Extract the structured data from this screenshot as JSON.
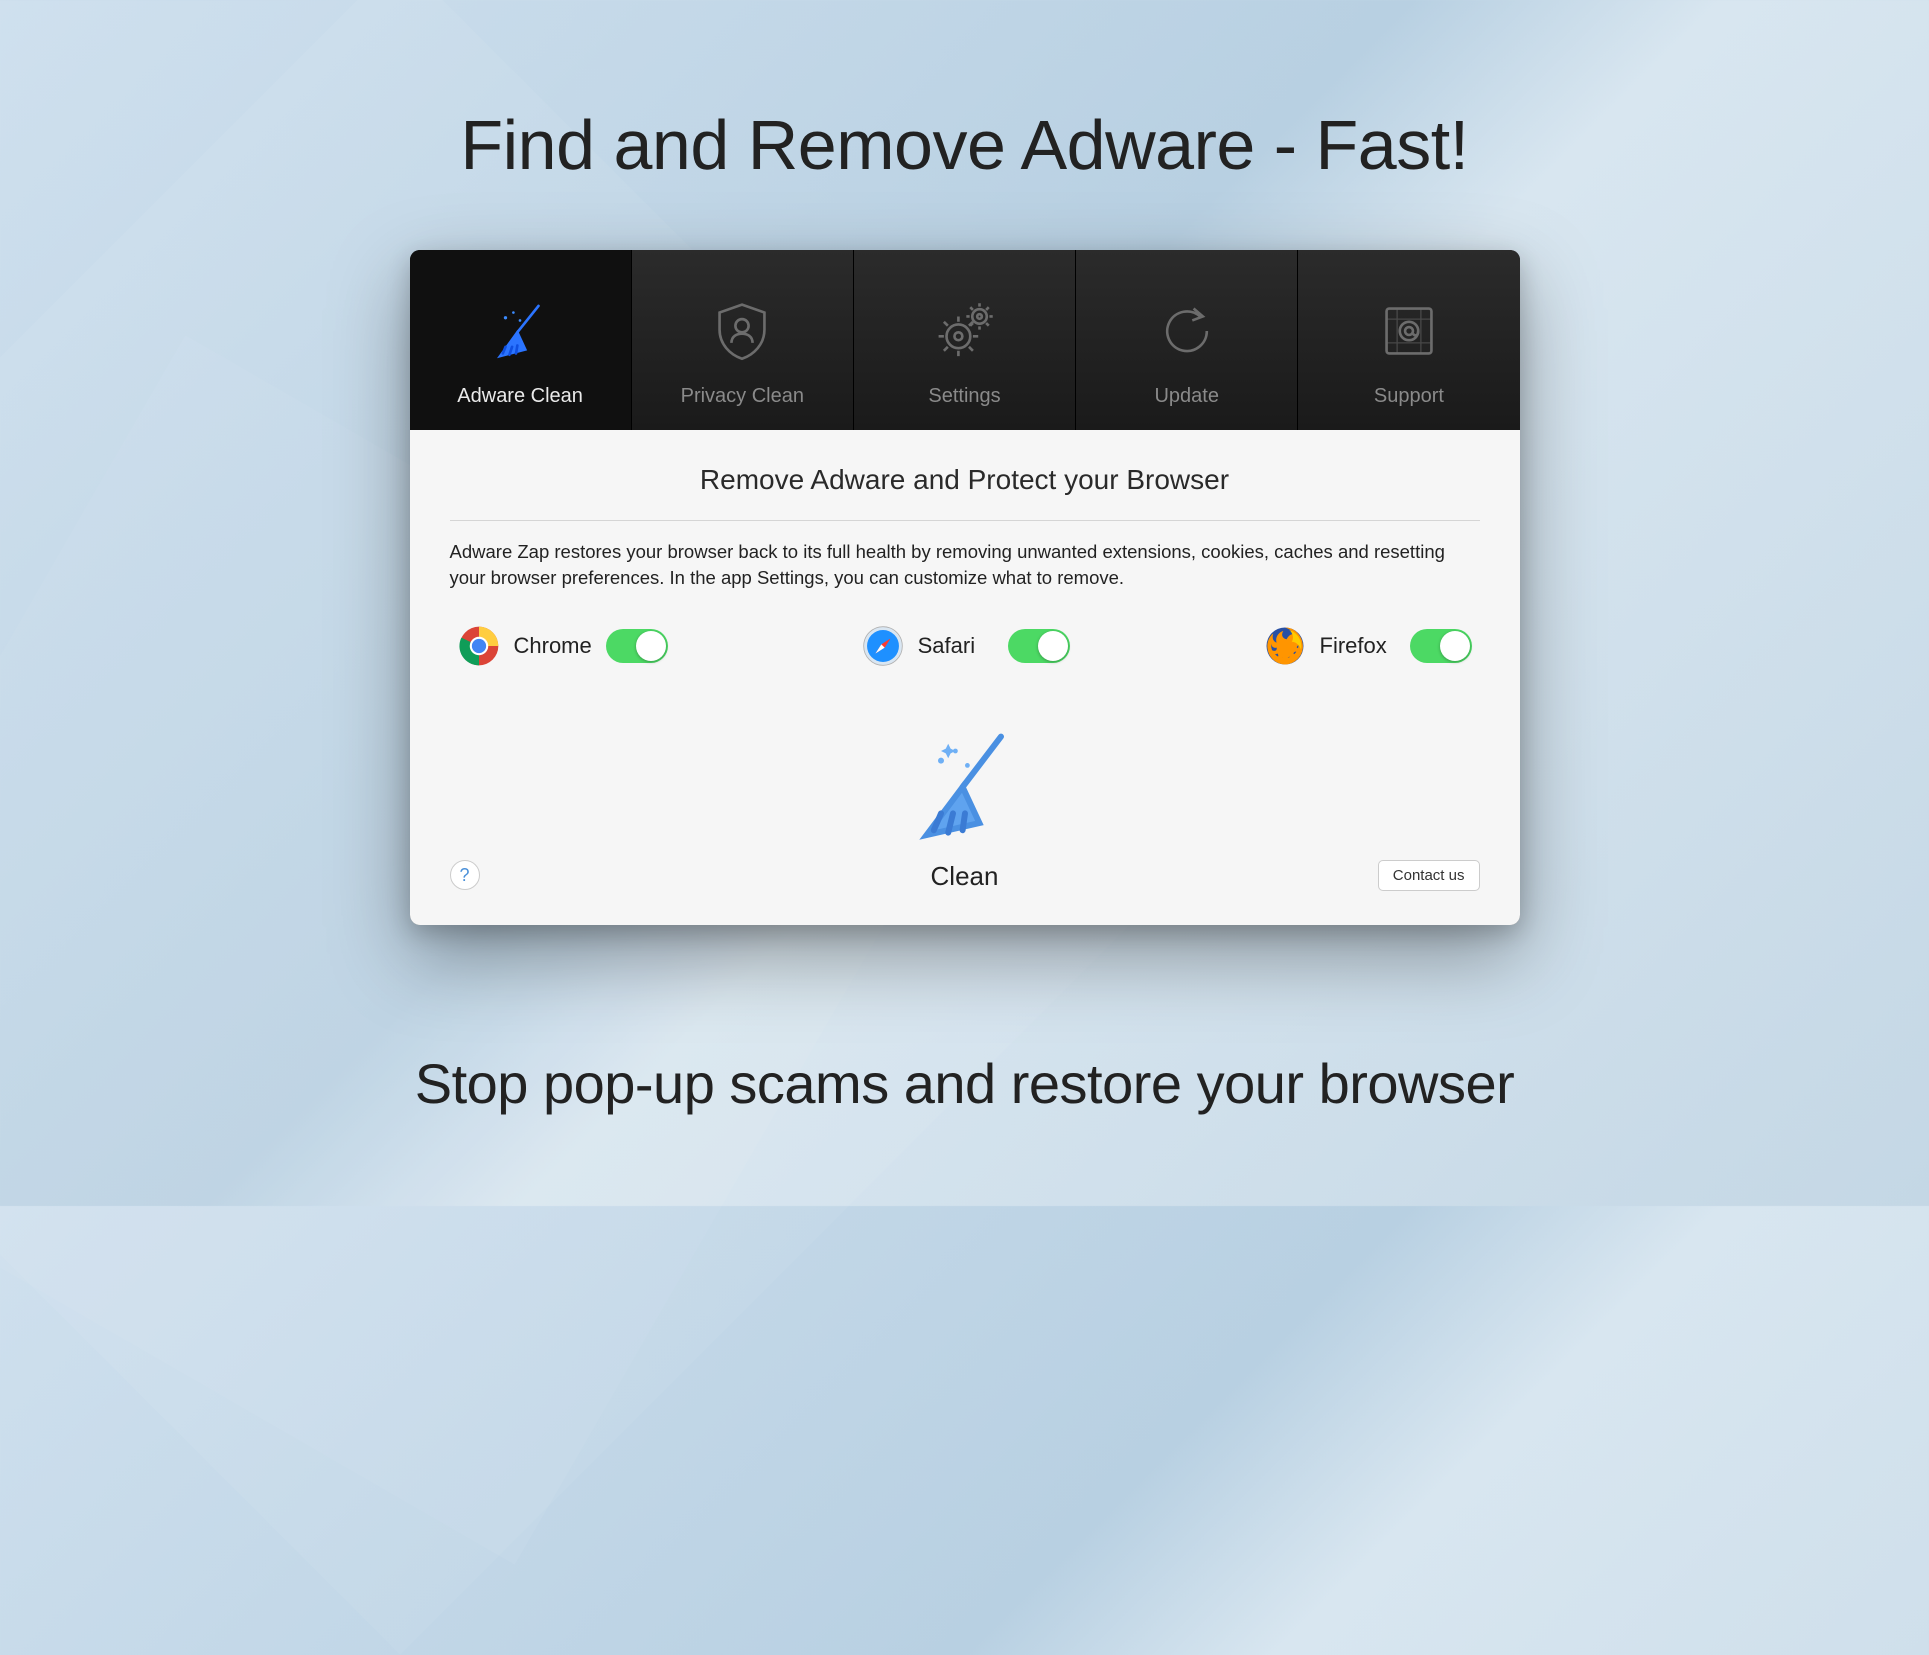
{
  "promo": {
    "headline": "Find and Remove Adware - Fast!",
    "subhead": "Stop pop-up scams and restore your browser"
  },
  "tabs": [
    {
      "id": "adware",
      "label": "Adware Clean",
      "active": true
    },
    {
      "id": "privacy",
      "label": "Privacy Clean",
      "active": false
    },
    {
      "id": "settings",
      "label": "Settings",
      "active": false
    },
    {
      "id": "update",
      "label": "Update",
      "active": false
    },
    {
      "id": "support",
      "label": "Support",
      "active": false
    }
  ],
  "main": {
    "title": "Remove Adware and Protect your Browser",
    "description": "Adware Zap restores your browser back to its full health by removing unwanted extensions, cookies, caches and resetting your browser preferences. In the app Settings, you can customize what to remove.",
    "browsers": [
      {
        "id": "chrome",
        "label": "Chrome",
        "enabled": true
      },
      {
        "id": "safari",
        "label": "Safari",
        "enabled": true
      },
      {
        "id": "firefox",
        "label": "Firefox",
        "enabled": true
      }
    ],
    "clean_label": "Clean",
    "help_label": "?",
    "contact_label": "Contact us"
  }
}
